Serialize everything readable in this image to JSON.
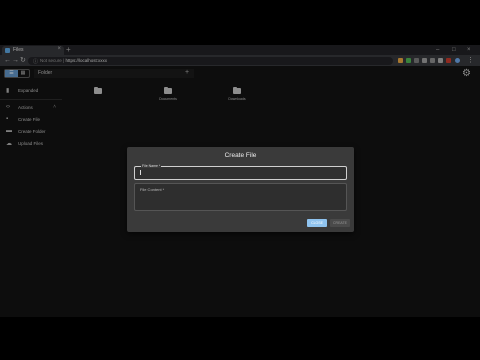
{
  "browser": {
    "tab_title": "Files",
    "tab_close": "×",
    "new_tab": "+",
    "url_secure_label": "Not secure",
    "url_host": "https://localhost:xxxx",
    "win_min": "–",
    "win_max": "□",
    "win_close": "×"
  },
  "toolbar": {
    "view_active": "☰",
    "view_inactive": "▦",
    "path_label": "Folder",
    "add_label": "+"
  },
  "sidebar": {
    "header_label": "Expanded",
    "section_label": "Actions",
    "items": [
      {
        "label": "Create File"
      },
      {
        "label": "Create Folder"
      },
      {
        "label": "Upload Files"
      }
    ]
  },
  "folders": [
    {
      "label": ""
    },
    {
      "label": "Documents"
    },
    {
      "label": "Downloads"
    }
  ],
  "dialog": {
    "title": "Create File",
    "name_label": "File Name *",
    "content_label": "File Content *",
    "close_label": "CLOSE",
    "create_label": "CREATE"
  },
  "colors": {
    "accent": "#8fc3ef",
    "background": "#121212",
    "dialog": "#3a3a3a"
  }
}
